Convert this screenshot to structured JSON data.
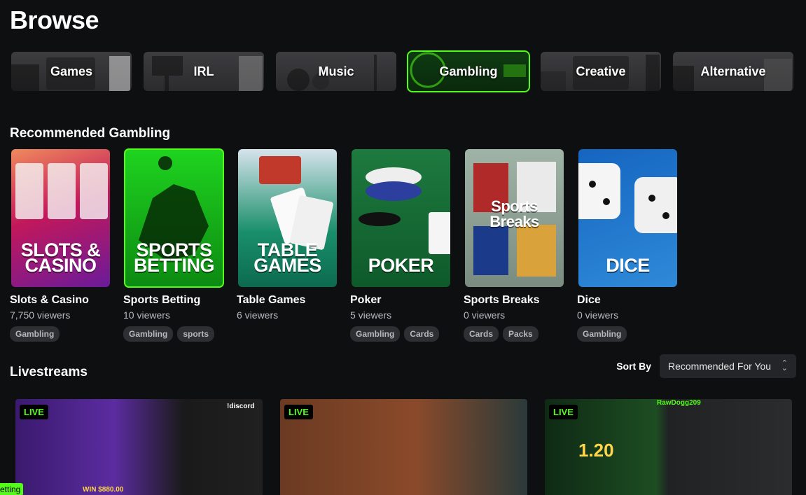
{
  "page": {
    "title": "Browse"
  },
  "categories": [
    {
      "label": "Games",
      "active": false
    },
    {
      "label": "IRL",
      "active": false
    },
    {
      "label": "Music",
      "active": false
    },
    {
      "label": "Gambling",
      "active": true
    },
    {
      "label": "Creative",
      "active": false
    },
    {
      "label": "Alternative",
      "active": false
    }
  ],
  "recommended": {
    "title": "Recommended Gambling",
    "items": [
      {
        "name": "Slots & Casino",
        "viewers": "7,750 viewers",
        "thumb_text": "SLOTS & CASINO",
        "tags": [
          "Gambling"
        ]
      },
      {
        "name": "Sports Betting",
        "viewers": "10 viewers",
        "thumb_text": "SPORTS BETTING",
        "tags": [
          "Gambling",
          "sports"
        ]
      },
      {
        "name": "Table Games",
        "viewers": "6 viewers",
        "thumb_text": "TABLE GAMES",
        "tags": []
      },
      {
        "name": "Poker",
        "viewers": "5 viewers",
        "thumb_text": "POKER",
        "tags": [
          "Gambling",
          "Cards"
        ]
      },
      {
        "name": "Sports Breaks",
        "viewers": "0 viewers",
        "thumb_text": "Sports Breaks",
        "tags": [
          "Cards",
          "Packs"
        ]
      },
      {
        "name": "Dice",
        "viewers": "0 viewers",
        "thumb_text": "DICE",
        "tags": [
          "Gambling"
        ]
      }
    ]
  },
  "livestreams": {
    "title": "Livestreams",
    "sort_label": "Sort By",
    "sort_value": "Recommended For You",
    "streams": [
      {
        "badge": "LIVE",
        "overlay_texts": [
          "!discord",
          "WIN $880.00"
        ]
      },
      {
        "badge": "LIVE",
        "overlay_texts": []
      },
      {
        "badge": "LIVE",
        "overlay_texts": [
          "1.20",
          "RawDogg209"
        ]
      }
    ]
  },
  "tooltip": {
    "text": "etting"
  },
  "colors": {
    "accent": "#53fc18",
    "background": "#0e0f11",
    "tag_bg": "#2d2f33"
  }
}
